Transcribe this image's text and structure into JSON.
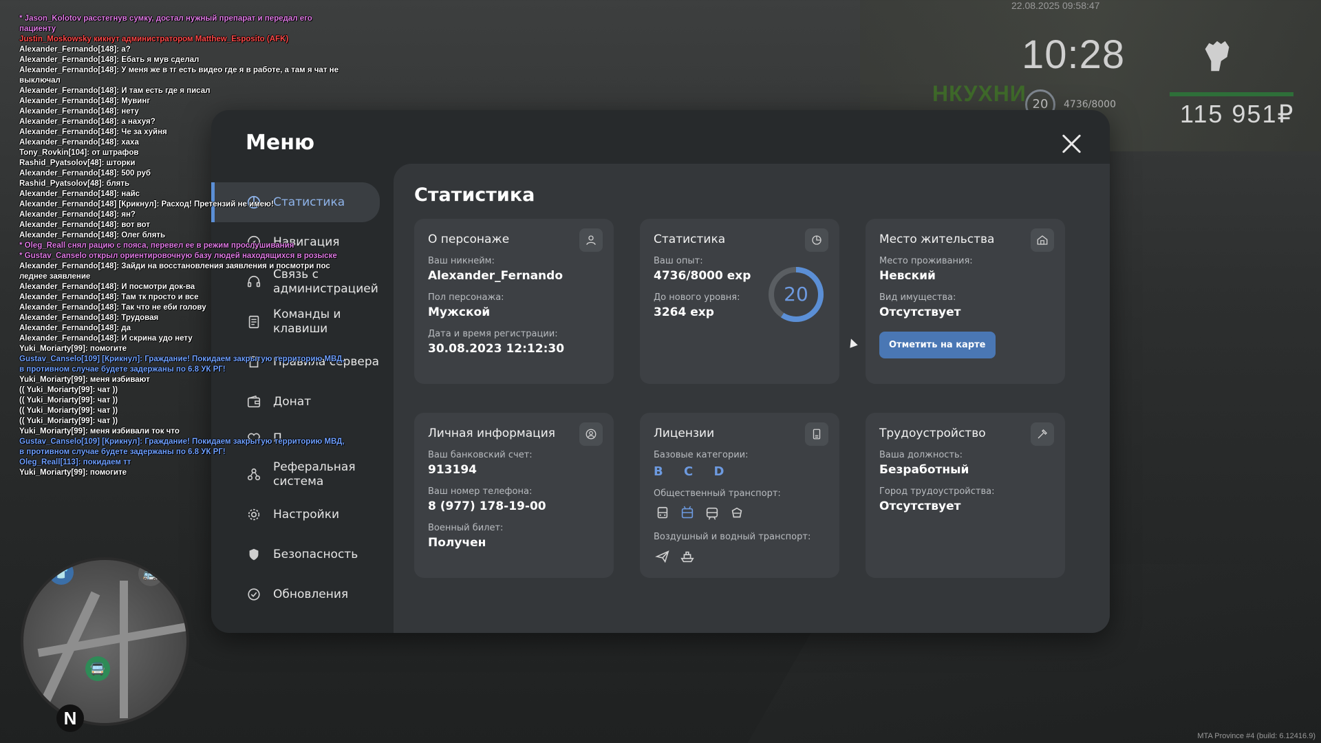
{
  "hud": {
    "datetime": "22.08.2025 09:58:47",
    "time": "10:28",
    "level": "20",
    "exp": "4736/8000",
    "money": "115 951₽",
    "build": "MTA Province #4 (build: 6.12416.9)",
    "sign": "НКУХНИ"
  },
  "chat": [
    {
      "text": "* Jason_Kolotov расстегнув сумку, достал нужный препарат и передал его пациенту",
      "color": "#e07ce6"
    },
    {
      "text": "Justin_Moskowsky кикнут администратором Matthew_Esposito (AFK)",
      "color": "#ff4a4a"
    },
    {
      "text": "Alexander_Fernando[148]: а?",
      "color": "#ffffff"
    },
    {
      "text": "Alexander_Fernando[148]: Ебать я мув сделал",
      "color": "#ffffff"
    },
    {
      "text": "Alexander_Fernando[148]: У меня же в тг есть видео где я в работе, а там я чат не выключал",
      "color": "#ffffff"
    },
    {
      "text": "Alexander_Fernando[148]: И там есть где я писал",
      "color": "#ffffff"
    },
    {
      "text": "Alexander_Fernando[148]: Мувинг",
      "color": "#ffffff"
    },
    {
      "text": "Alexander_Fernando[148]: нету",
      "color": "#ffffff"
    },
    {
      "text": "Alexander_Fernando[148]: а нахуя?",
      "color": "#ffffff"
    },
    {
      "text": "Alexander_Fernando[148]: Че за хуйня",
      "color": "#ffffff"
    },
    {
      "text": "Alexander_Fernando[148]: хаха",
      "color": "#ffffff"
    },
    {
      "text": "Tony_Rovkin[104]: от штрафов",
      "color": "#ffffff"
    },
    {
      "text": "Rashid_Pyatsolov[48]: шторки",
      "color": "#ffffff"
    },
    {
      "text": "Alexander_Fernando[148]: 500 руб",
      "color": "#ffffff"
    },
    {
      "text": "Rashid_Pyatsolov[48]: блять",
      "color": "#ffffff"
    },
    {
      "text": "Alexander_Fernando[148]: найс",
      "color": "#ffffff"
    },
    {
      "text": "Alexander_Fernando[148] [Крикнул]: Расход! Претензий не имею!",
      "color": "#ffffff"
    },
    {
      "text": "Alexander_Fernando[148]: ян?",
      "color": "#ffffff"
    },
    {
      "text": "Alexander_Fernando[148]: вот вот",
      "color": "#ffffff"
    },
    {
      "text": "Alexander_Fernando[148]: Олег блять",
      "color": "#ffffff"
    },
    {
      "text": "* Oleg_Reall снял рацию с пояса, перевел ее в режим прослушивания",
      "color": "#e07ce6"
    },
    {
      "text": "* Gustav_Canselo открыл ориентировочную базу людей находящихся в розыске",
      "color": "#e07ce6"
    },
    {
      "text": "Alexander_Fernando[148]: Зайди на восстановления заявления и посмотри пос леднее заявление",
      "color": "#ffffff"
    },
    {
      "text": "Alexander_Fernando[148]: И посмотри док-ва",
      "color": "#ffffff"
    },
    {
      "text": "Alexander_Fernando[148]: Там тк просто и все",
      "color": "#ffffff"
    },
    {
      "text": "Alexander_Fernando[148]: Так что не еби голову",
      "color": "#ffffff"
    },
    {
      "text": "Alexander_Fernando[148]: Трудовая",
      "color": "#ffffff"
    },
    {
      "text": "Alexander_Fernando[148]: да",
      "color": "#ffffff"
    },
    {
      "text": "Alexander_Fernando[148]: И скрина удо нету",
      "color": "#ffffff"
    },
    {
      "text": "Yuki_Moriarty[99]: помогите",
      "color": "#ffffff"
    },
    {
      "text": "Gustav_Canselo[109] [Крикнул]: Граждание! Покидаем закрытую территорию МВД, в противном случае будете задержаны по 6.8 УК РГ!",
      "color": "#6fa0ff"
    },
    {
      "text": "Yuki_Moriarty[99]: меня избивают",
      "color": "#ffffff"
    },
    {
      "text": "(( Yuki_Moriarty[99]: чат ))",
      "color": "#ffffff"
    },
    {
      "text": "(( Yuki_Moriarty[99]: чат ))",
      "color": "#ffffff"
    },
    {
      "text": "(( Yuki_Moriarty[99]: чат ))",
      "color": "#ffffff"
    },
    {
      "text": "(( Yuki_Moriarty[99]: чат ))",
      "color": "#ffffff"
    },
    {
      "text": "Yuki_Moriarty[99]: меня избивали ток что",
      "color": "#ffffff"
    },
    {
      "text": "Gustav_Canselo[109] [Крикнул]: Граждание! Покидаем закрытую территорию МВД, в противном случае будете задержаны по 6.8 УК РГ!",
      "color": "#6fa0ff"
    },
    {
      "text": "Oleg_Reall[113]: покидаем тт",
      "color": "#6fa0ff"
    },
    {
      "text": "Yuki_Moriarty[99]: помогите",
      "color": "#ffffff"
    }
  ],
  "menu": {
    "title": "Меню",
    "nav": [
      {
        "label": "Статистика",
        "active": true
      },
      {
        "label": "Навигация"
      },
      {
        "label": "Связь с администрацией"
      },
      {
        "label": "Команды и клавиши"
      },
      {
        "label": "Правила сервера"
      },
      {
        "label": "Донат"
      },
      {
        "label": "П"
      },
      {
        "label": "Реферальная система"
      },
      {
        "label": "Настройки"
      },
      {
        "label": "Безопасность"
      },
      {
        "label": "Обновления"
      }
    ],
    "content_title": "Статистика"
  },
  "cards": {
    "character": {
      "title": "О персонаже",
      "nickname_label": "Ваш никнейм:",
      "nickname": "Alexander_Fernando",
      "gender_label": "Пол персонажа:",
      "gender": "Мужской",
      "reg_label": "Дата и время регистрации:",
      "reg": "30.08.2023 12:12:30"
    },
    "stats": {
      "title": "Статистика",
      "exp_label": "Ваш опыт:",
      "exp": "4736/8000 exp",
      "next_label": "До нового уровня:",
      "next": "3264 exp",
      "level": "20",
      "progress": 0.592
    },
    "residence": {
      "title": "Место жительства",
      "place_label": "Место проживания:",
      "place": "Невский",
      "property_label": "Вид имущества:",
      "property": "Отсутствует",
      "map_button": "Отметить на карте"
    },
    "personal": {
      "title": "Личная информация",
      "bank_label": "Ваш банковский счет:",
      "bank": "913194",
      "phone_label": "Ваш номер телефона:",
      "phone": "8 (977) 178-19-00",
      "military_label": "Военный билет:",
      "military": "Получен"
    },
    "licenses": {
      "title": "Лицензии",
      "base_label": "Базовые категории:",
      "base": "B C D",
      "public_label": "Общественный транспорт:",
      "air_label": "Воздушный и водный транспорт:"
    },
    "employment": {
      "title": "Трудоустройство",
      "position_label": "Ваша должность:",
      "position": "Безработный",
      "city_label": "Город трудоустройства:",
      "city": "Отсутствует"
    }
  },
  "colors": {
    "accent": "#5b8fd6",
    "panel": "#272a2c",
    "card": "#3d4044"
  }
}
